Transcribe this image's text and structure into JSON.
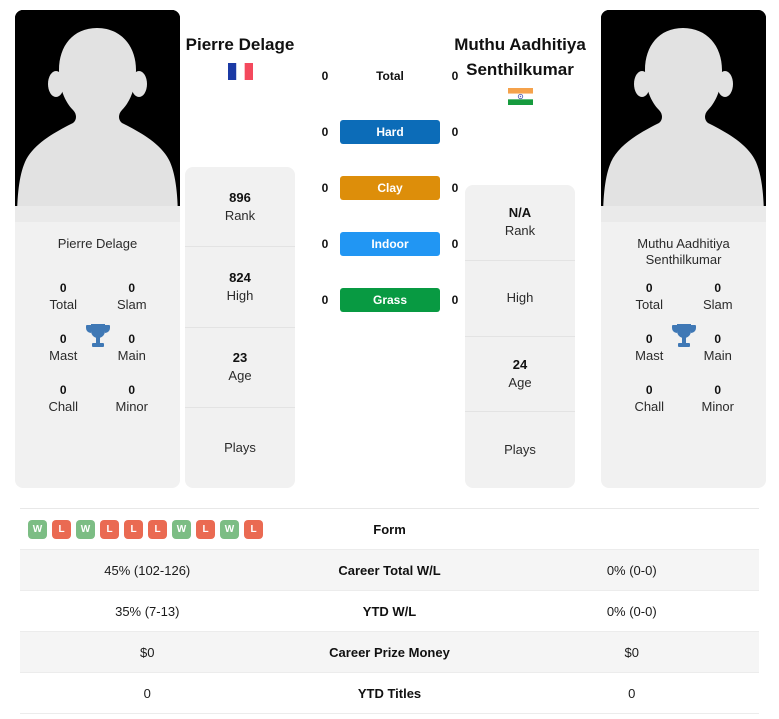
{
  "colors": {
    "hard": "#0c6cb8",
    "clay": "#dd8e0a",
    "indoor": "#2196f3",
    "grass": "#089a42",
    "win_badge": "#7cbd84",
    "loss_badge": "#ea6a52",
    "trophy": "#3f78b5",
    "card_bg": "#f1f1f1",
    "row_shaded": "#f5f5f5"
  },
  "players": {
    "left": {
      "name": "Pierre Delage",
      "card_name": "Pierre Delage",
      "flag": "france-flag-icon",
      "titles": [
        {
          "value": "0",
          "label": "Total"
        },
        {
          "value": "0",
          "label": "Slam"
        },
        {
          "value": "0",
          "label": "Mast"
        },
        {
          "value": "0",
          "label": "Main"
        },
        {
          "value": "0",
          "label": "Chall"
        },
        {
          "value": "0",
          "label": "Minor"
        }
      ],
      "stats": [
        {
          "value": "896",
          "label": "Rank"
        },
        {
          "value": "824",
          "label": "High"
        },
        {
          "value": "23",
          "label": "Age"
        },
        {
          "value": "",
          "label": "Plays"
        }
      ],
      "surface_counts": {
        "total": "0",
        "hard": "0",
        "clay": "0",
        "indoor": "0",
        "grass": "0"
      }
    },
    "right": {
      "name": "Muthu Aadhitiya Senthilkumar",
      "card_name": "Muthu Aadhitiya Senthilkumar",
      "flag": "india-flag-icon",
      "titles": [
        {
          "value": "0",
          "label": "Total"
        },
        {
          "value": "0",
          "label": "Slam"
        },
        {
          "value": "0",
          "label": "Mast"
        },
        {
          "value": "0",
          "label": "Main"
        },
        {
          "value": "0",
          "label": "Chall"
        },
        {
          "value": "0",
          "label": "Minor"
        }
      ],
      "stats": [
        {
          "value": "N/A",
          "label": "Rank"
        },
        {
          "value": "",
          "label": "High"
        },
        {
          "value": "24",
          "label": "Age"
        },
        {
          "value": "",
          "label": "Plays"
        }
      ],
      "surface_counts": {
        "total": "0",
        "hard": "0",
        "clay": "0",
        "indoor": "0",
        "grass": "0"
      }
    }
  },
  "surfaces": [
    {
      "key": "total",
      "label": "Total",
      "styled": false
    },
    {
      "key": "hard",
      "label": "Hard",
      "styled": true
    },
    {
      "key": "clay",
      "label": "Clay",
      "styled": true
    },
    {
      "key": "indoor",
      "label": "Indoor",
      "styled": true
    },
    {
      "key": "grass",
      "label": "Grass",
      "styled": true
    }
  ],
  "comparison_table": {
    "rows": [
      {
        "label": "Form",
        "left_form": [
          "W",
          "L",
          "W",
          "L",
          "L",
          "L",
          "W",
          "L",
          "W",
          "L"
        ],
        "right": ""
      },
      {
        "label": "Career Total W/L",
        "left": "45% (102-126)",
        "right": "0% (0-0)"
      },
      {
        "label": "YTD W/L",
        "left": "35% (7-13)",
        "right": "0% (0-0)"
      },
      {
        "label": "Career Prize Money",
        "left": "$0",
        "right": "$0"
      },
      {
        "label": "YTD Titles",
        "left": "0",
        "right": "0"
      }
    ]
  }
}
